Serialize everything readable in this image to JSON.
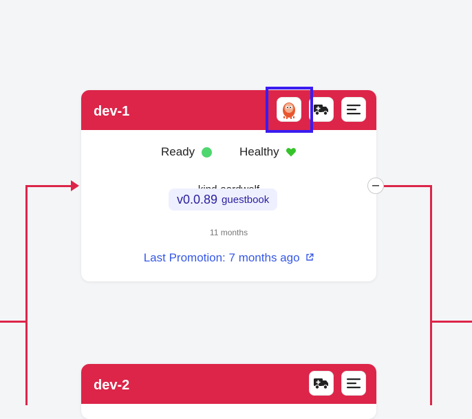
{
  "colors": {
    "accent": "#dc2549",
    "highlight": "#3a1cf0",
    "background": "#f4f5f7",
    "ready": "#4ed66f",
    "healthy": "#35c32a",
    "link": "#3658e6"
  },
  "stages": [
    {
      "name": "dev-1",
      "status": {
        "ready_label": "Ready",
        "healthy_label": "Healthy"
      },
      "freight": {
        "name": "kind-aardwolf",
        "version": "v0.0.89",
        "image": "guestbook",
        "age": "11 months"
      },
      "last_promotion_label": "Last Promotion:",
      "last_promotion_time": "7 months ago",
      "icons": [
        "argo-mascot-icon",
        "promote-truck-icon",
        "menu-icon"
      ]
    },
    {
      "name": "dev-2",
      "icons": [
        "promote-truck-icon",
        "menu-icon"
      ]
    }
  ]
}
